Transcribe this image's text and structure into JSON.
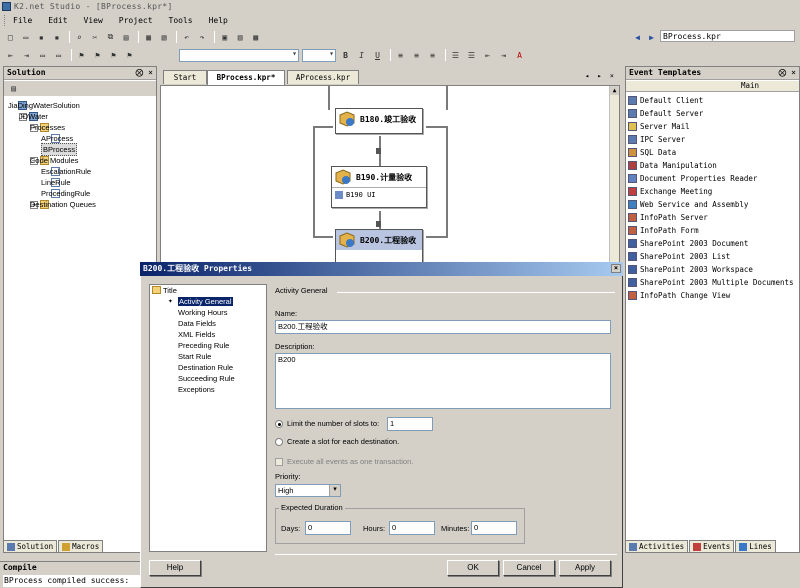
{
  "window": {
    "title": "K2.net Studio - [BProcess.kpr*]"
  },
  "menu": [
    "File",
    "Edit",
    "View",
    "Project",
    "Tools",
    "Help"
  ],
  "nav": {
    "path": "BProcess.kpr"
  },
  "solution": {
    "title": "Solution",
    "ctrls": "⨂ ×",
    "tree": [
      {
        "label": "JiaDingWaterSolution",
        "indent": 0,
        "icon": "proj",
        "exp": ""
      },
      {
        "label": "JDWater",
        "indent": 1,
        "icon": "proj",
        "exp": "−"
      },
      {
        "label": "Processes",
        "indent": 2,
        "icon": "folder",
        "exp": "−"
      },
      {
        "label": "AProcess",
        "indent": 3,
        "icon": "file",
        "exp": ""
      },
      {
        "label": "BProcess",
        "indent": 3,
        "icon": "file",
        "exp": "",
        "selected": true
      },
      {
        "label": "Code Modules",
        "indent": 2,
        "icon": "folder",
        "exp": "−"
      },
      {
        "label": "EscalationRule",
        "indent": 3,
        "icon": "file",
        "exp": ""
      },
      {
        "label": "LineRule",
        "indent": 3,
        "icon": "file",
        "exp": ""
      },
      {
        "label": "ProcedingRule",
        "indent": 3,
        "icon": "file",
        "exp": ""
      },
      {
        "label": "Destination Queues",
        "indent": 2,
        "icon": "folder",
        "exp": "+"
      }
    ],
    "tabs": [
      "Solution",
      "Macros"
    ]
  },
  "compile": {
    "title": "Compile",
    "output": "BProcess compiled success:"
  },
  "doc_tabs": [
    {
      "label": "Start",
      "active": false
    },
    {
      "label": "BProcess.kpr*",
      "active": true
    },
    {
      "label": "AProcess.kpr",
      "active": false
    }
  ],
  "doc_tab_ctrls": "◂ ▸ ×",
  "canvas": {
    "nodes": [
      {
        "label": "B180.竣工验收",
        "body": ""
      },
      {
        "label": "B190.计量验收",
        "body": "B190 UI"
      },
      {
        "label": "B200.工程验收",
        "body": ""
      }
    ]
  },
  "event_templates": {
    "title": "Event Templates",
    "ctrls": "⨂ ×",
    "column": "Main",
    "items": [
      {
        "label": "Default Client",
        "color": "#5a7ab0"
      },
      {
        "label": "Default Server",
        "color": "#5a7ab0"
      },
      {
        "label": "Server Mail",
        "color": "#e0c050"
      },
      {
        "label": "IPC Server",
        "color": "#5a7ab0"
      },
      {
        "label": "SQL Data",
        "color": "#d09040"
      },
      {
        "label": "Data Manipulation",
        "color": "#b04040"
      },
      {
        "label": "Document Properties Reader",
        "color": "#6080c0"
      },
      {
        "label": "Exchange Meeting",
        "color": "#c04040"
      },
      {
        "label": "Web Service and Assembly",
        "color": "#4080c0"
      },
      {
        "label": "InfoPath Server",
        "color": "#c06040"
      },
      {
        "label": "InfoPath Form",
        "color": "#c06040"
      },
      {
        "label": "SharePoint 2003 Document",
        "color": "#4060a0"
      },
      {
        "label": "SharePoint 2003 List",
        "color": "#4060a0"
      },
      {
        "label": "SharePoint 2003 Workspace",
        "color": "#4060a0"
      },
      {
        "label": "SharePoint 2003 Multiple Documents",
        "color": "#4060a0"
      },
      {
        "label": "InfoPath Change View",
        "color": "#c06040"
      }
    ],
    "tabs": [
      "Activities",
      "Events",
      "Lines"
    ]
  },
  "dialog": {
    "title": "B200.工程验收 Properties",
    "close": "×",
    "tree_root": "Title",
    "tree_items": [
      "Activity General",
      "Working Hours",
      "Data Fields",
      "XML Fields",
      "Preceding Rule",
      "Start Rule",
      "Destination Rule",
      "Succeeding Rule",
      "Exceptions"
    ],
    "selected_item": "Activity General",
    "section": "Activity General",
    "name_label": "Name:",
    "name_value": "B200.工程验收",
    "description_label": "Description:",
    "description_value": "B200",
    "limit_slots_label": "Limit the number of slots  to:",
    "slots_value": "1",
    "create_slot_label": "Create a slot for each destination.",
    "execute_all_label": "Execute all events as one transaction.",
    "priority_label": "Priority:",
    "priority_value": "High",
    "expected_duration_label": "Expected Duration",
    "days_label": "Days:",
    "days_value": "0",
    "hours_label": "Hours:",
    "hours_value": "0",
    "minutes_label": "Minutes:",
    "minutes_value": "0",
    "help_button": "Help",
    "ok_button": "OK",
    "cancel_button": "Cancel",
    "apply_button": "Apply"
  }
}
